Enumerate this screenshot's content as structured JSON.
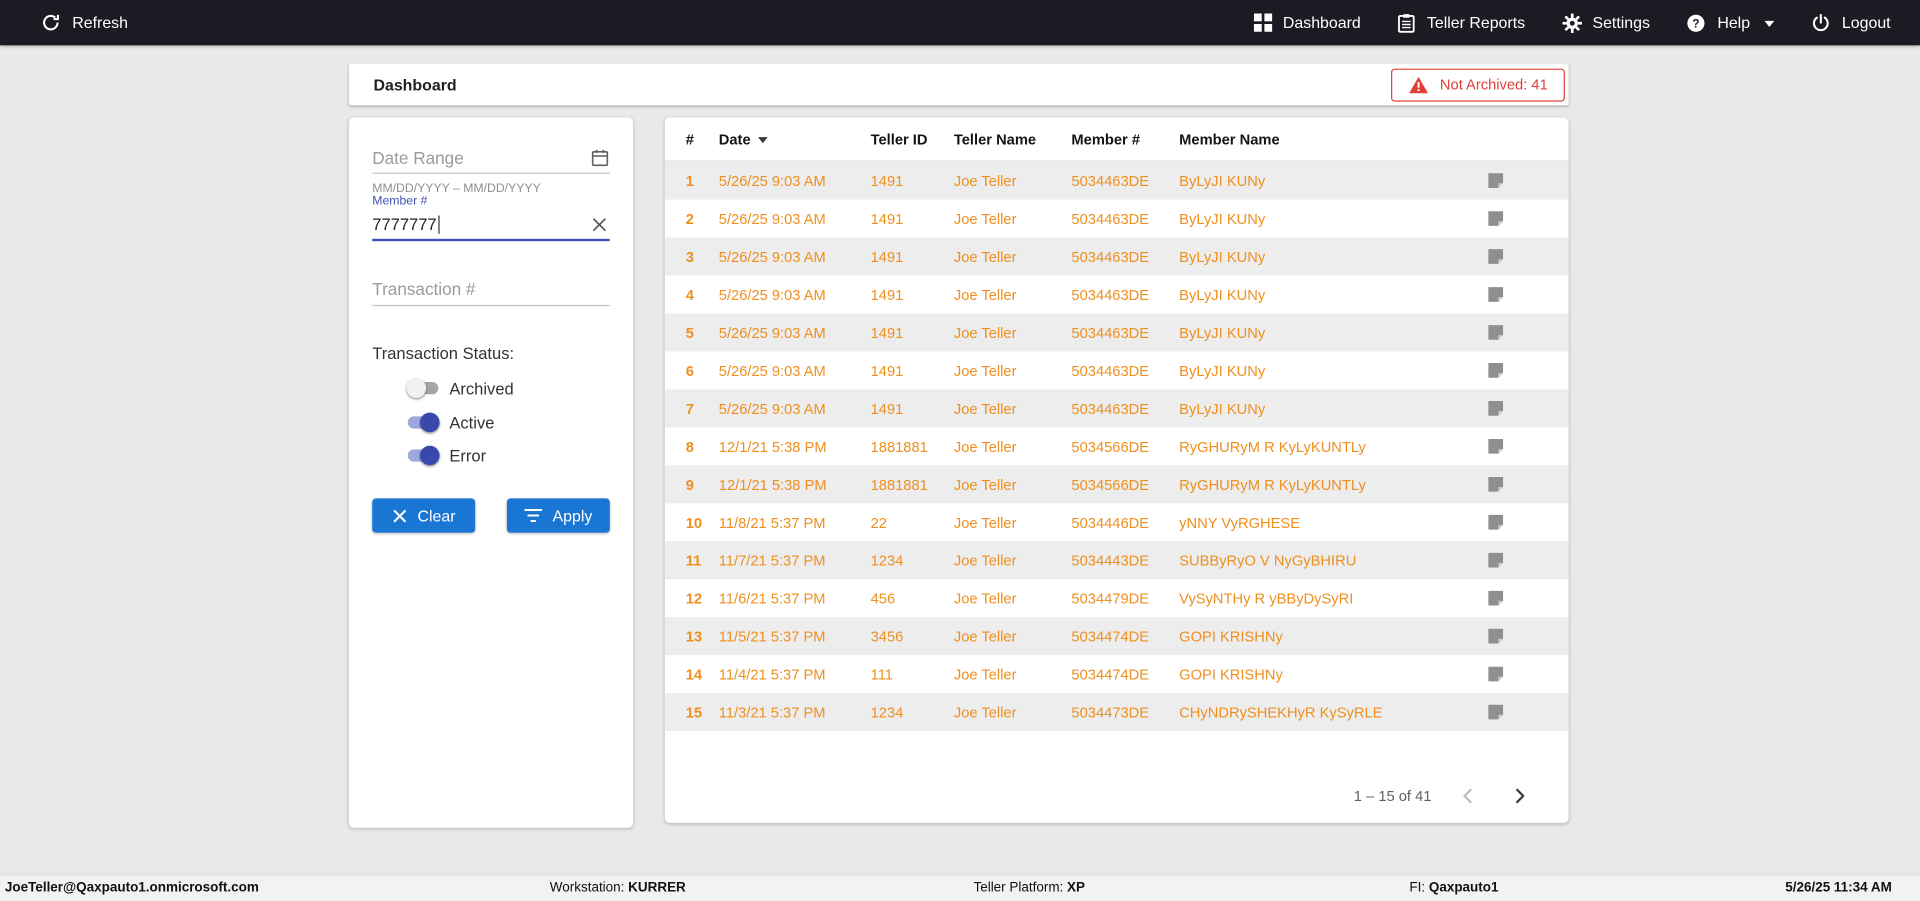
{
  "topbar": {
    "refresh_label": "Refresh",
    "nav": [
      {
        "label": "Dashboard",
        "icon": "dashboard-icon"
      },
      {
        "label": "Teller Reports",
        "icon": "reports-icon"
      },
      {
        "label": "Settings",
        "icon": "gear-icon"
      },
      {
        "label": "Help",
        "icon": "help-icon"
      },
      {
        "label": "Logout",
        "icon": "power-icon"
      }
    ]
  },
  "header": {
    "title": "Dashboard",
    "badge": "Not Archived: 41"
  },
  "filters": {
    "date_range_placeholder": "Date Range",
    "date_range_hint": "MM/DD/YYYY – MM/DD/YYYY",
    "member_label": "Member #",
    "member_value": "7777777",
    "transaction_placeholder": "Transaction #",
    "status_label": "Transaction Status:",
    "toggles": [
      {
        "label": "Archived",
        "on": false
      },
      {
        "label": "Active",
        "on": true
      },
      {
        "label": "Error",
        "on": true
      }
    ],
    "clear_label": "Clear",
    "apply_label": "Apply"
  },
  "table": {
    "columns": [
      "#",
      "Date",
      "Teller ID",
      "Teller Name",
      "Member #",
      "Member Name"
    ],
    "rows": [
      {
        "num": "1",
        "date": "5/26/25 9:03 AM",
        "teller_id": "1491",
        "teller_name": "Joe Teller",
        "member_num": "5034463DE",
        "member_name": "ByLyJI KUNy"
      },
      {
        "num": "2",
        "date": "5/26/25 9:03 AM",
        "teller_id": "1491",
        "teller_name": "Joe Teller",
        "member_num": "5034463DE",
        "member_name": "ByLyJI KUNy"
      },
      {
        "num": "3",
        "date": "5/26/25 9:03 AM",
        "teller_id": "1491",
        "teller_name": "Joe Teller",
        "member_num": "5034463DE",
        "member_name": "ByLyJI KUNy"
      },
      {
        "num": "4",
        "date": "5/26/25 9:03 AM",
        "teller_id": "1491",
        "teller_name": "Joe Teller",
        "member_num": "5034463DE",
        "member_name": "ByLyJI KUNy"
      },
      {
        "num": "5",
        "date": "5/26/25 9:03 AM",
        "teller_id": "1491",
        "teller_name": "Joe Teller",
        "member_num": "5034463DE",
        "member_name": "ByLyJI KUNy"
      },
      {
        "num": "6",
        "date": "5/26/25 9:03 AM",
        "teller_id": "1491",
        "teller_name": "Joe Teller",
        "member_num": "5034463DE",
        "member_name": "ByLyJI KUNy"
      },
      {
        "num": "7",
        "date": "5/26/25 9:03 AM",
        "teller_id": "1491",
        "teller_name": "Joe Teller",
        "member_num": "5034463DE",
        "member_name": "ByLyJI KUNy"
      },
      {
        "num": "8",
        "date": "12/1/21 5:38 PM",
        "teller_id": "1881881",
        "teller_name": "Joe Teller",
        "member_num": "5034566DE",
        "member_name": "RyGHURyM R KyLyKUNTLy"
      },
      {
        "num": "9",
        "date": "12/1/21 5:38 PM",
        "teller_id": "1881881",
        "teller_name": "Joe Teller",
        "member_num": "5034566DE",
        "member_name": "RyGHURyM R KyLyKUNTLy"
      },
      {
        "num": "10",
        "date": "11/8/21 5:37 PM",
        "teller_id": "22",
        "teller_name": "Joe Teller",
        "member_num": "5034446DE",
        "member_name": "yNNY VyRGHESE"
      },
      {
        "num": "11",
        "date": "11/7/21 5:37 PM",
        "teller_id": "1234",
        "teller_name": "Joe Teller",
        "member_num": "5034443DE",
        "member_name": "SUBByRyO V NyGyBHIRU"
      },
      {
        "num": "12",
        "date": "11/6/21 5:37 PM",
        "teller_id": "456",
        "teller_name": "Joe Teller",
        "member_num": "5034479DE",
        "member_name": "VySyNTHy R yBByDySyRI"
      },
      {
        "num": "13",
        "date": "11/5/21 5:37 PM",
        "teller_id": "3456",
        "teller_name": "Joe Teller",
        "member_num": "5034474DE",
        "member_name": "GOPI KRISHNy"
      },
      {
        "num": "14",
        "date": "11/4/21 5:37 PM",
        "teller_id": "111",
        "teller_name": "Joe Teller",
        "member_num": "5034474DE",
        "member_name": "GOPI KRISHNy"
      },
      {
        "num": "15",
        "date": "11/3/21 5:37 PM",
        "teller_id": "1234",
        "teller_name": "Joe Teller",
        "member_num": "5034473DE",
        "member_name": "CHyNDRySHEKHyR KySyRLE"
      }
    ],
    "pagination": {
      "range": "1 – 15 of 41"
    }
  },
  "statusbar": {
    "user": "JoeTeller@Qaxpauto1.onmicrosoft.com",
    "workstation_label": "Workstation:",
    "workstation_value": "KURRER",
    "platform_label": "Teller Platform:",
    "platform_value": "XP",
    "fi_label": "FI:",
    "fi_value": "Qaxpauto1",
    "datetime": "5/26/25 11:34 AM"
  },
  "colors": {
    "topbar_bg": "#1b1b23",
    "accent_blue": "#1976d2",
    "toggle_on_blue": "#3949ab",
    "row_text_orange": "#ef8f1d",
    "alert_red": "#e04038"
  }
}
